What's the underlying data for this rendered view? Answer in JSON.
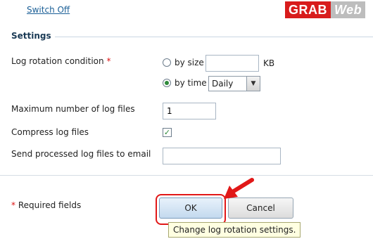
{
  "watermark": {
    "part1": "GRAB",
    "part2": "Web"
  },
  "switch_off_link": "Switch Off",
  "settings": {
    "legend": "Settings",
    "log_rotation": {
      "label": "Log rotation condition",
      "required_mark": "*",
      "by_size_label": "by size",
      "size_value": "",
      "size_unit": "KB",
      "by_time_label": "by time",
      "time_selected": "Daily",
      "selected_option": "by time"
    },
    "max_files": {
      "label": "Maximum number of log files",
      "value": "1"
    },
    "compress": {
      "label": "Compress log files",
      "checked": true
    },
    "email": {
      "label": "Send processed log files to email",
      "value": ""
    }
  },
  "footer": {
    "required_note_mark": "*",
    "required_note": "Required fields",
    "ok_label": "OK",
    "cancel_label": "Cancel",
    "tooltip": "Change log rotation settings."
  },
  "colors": {
    "link": "#1b5f97",
    "highlight": "#e11818",
    "arrow": "#e11818",
    "accent_green": "#2e8a3a"
  }
}
